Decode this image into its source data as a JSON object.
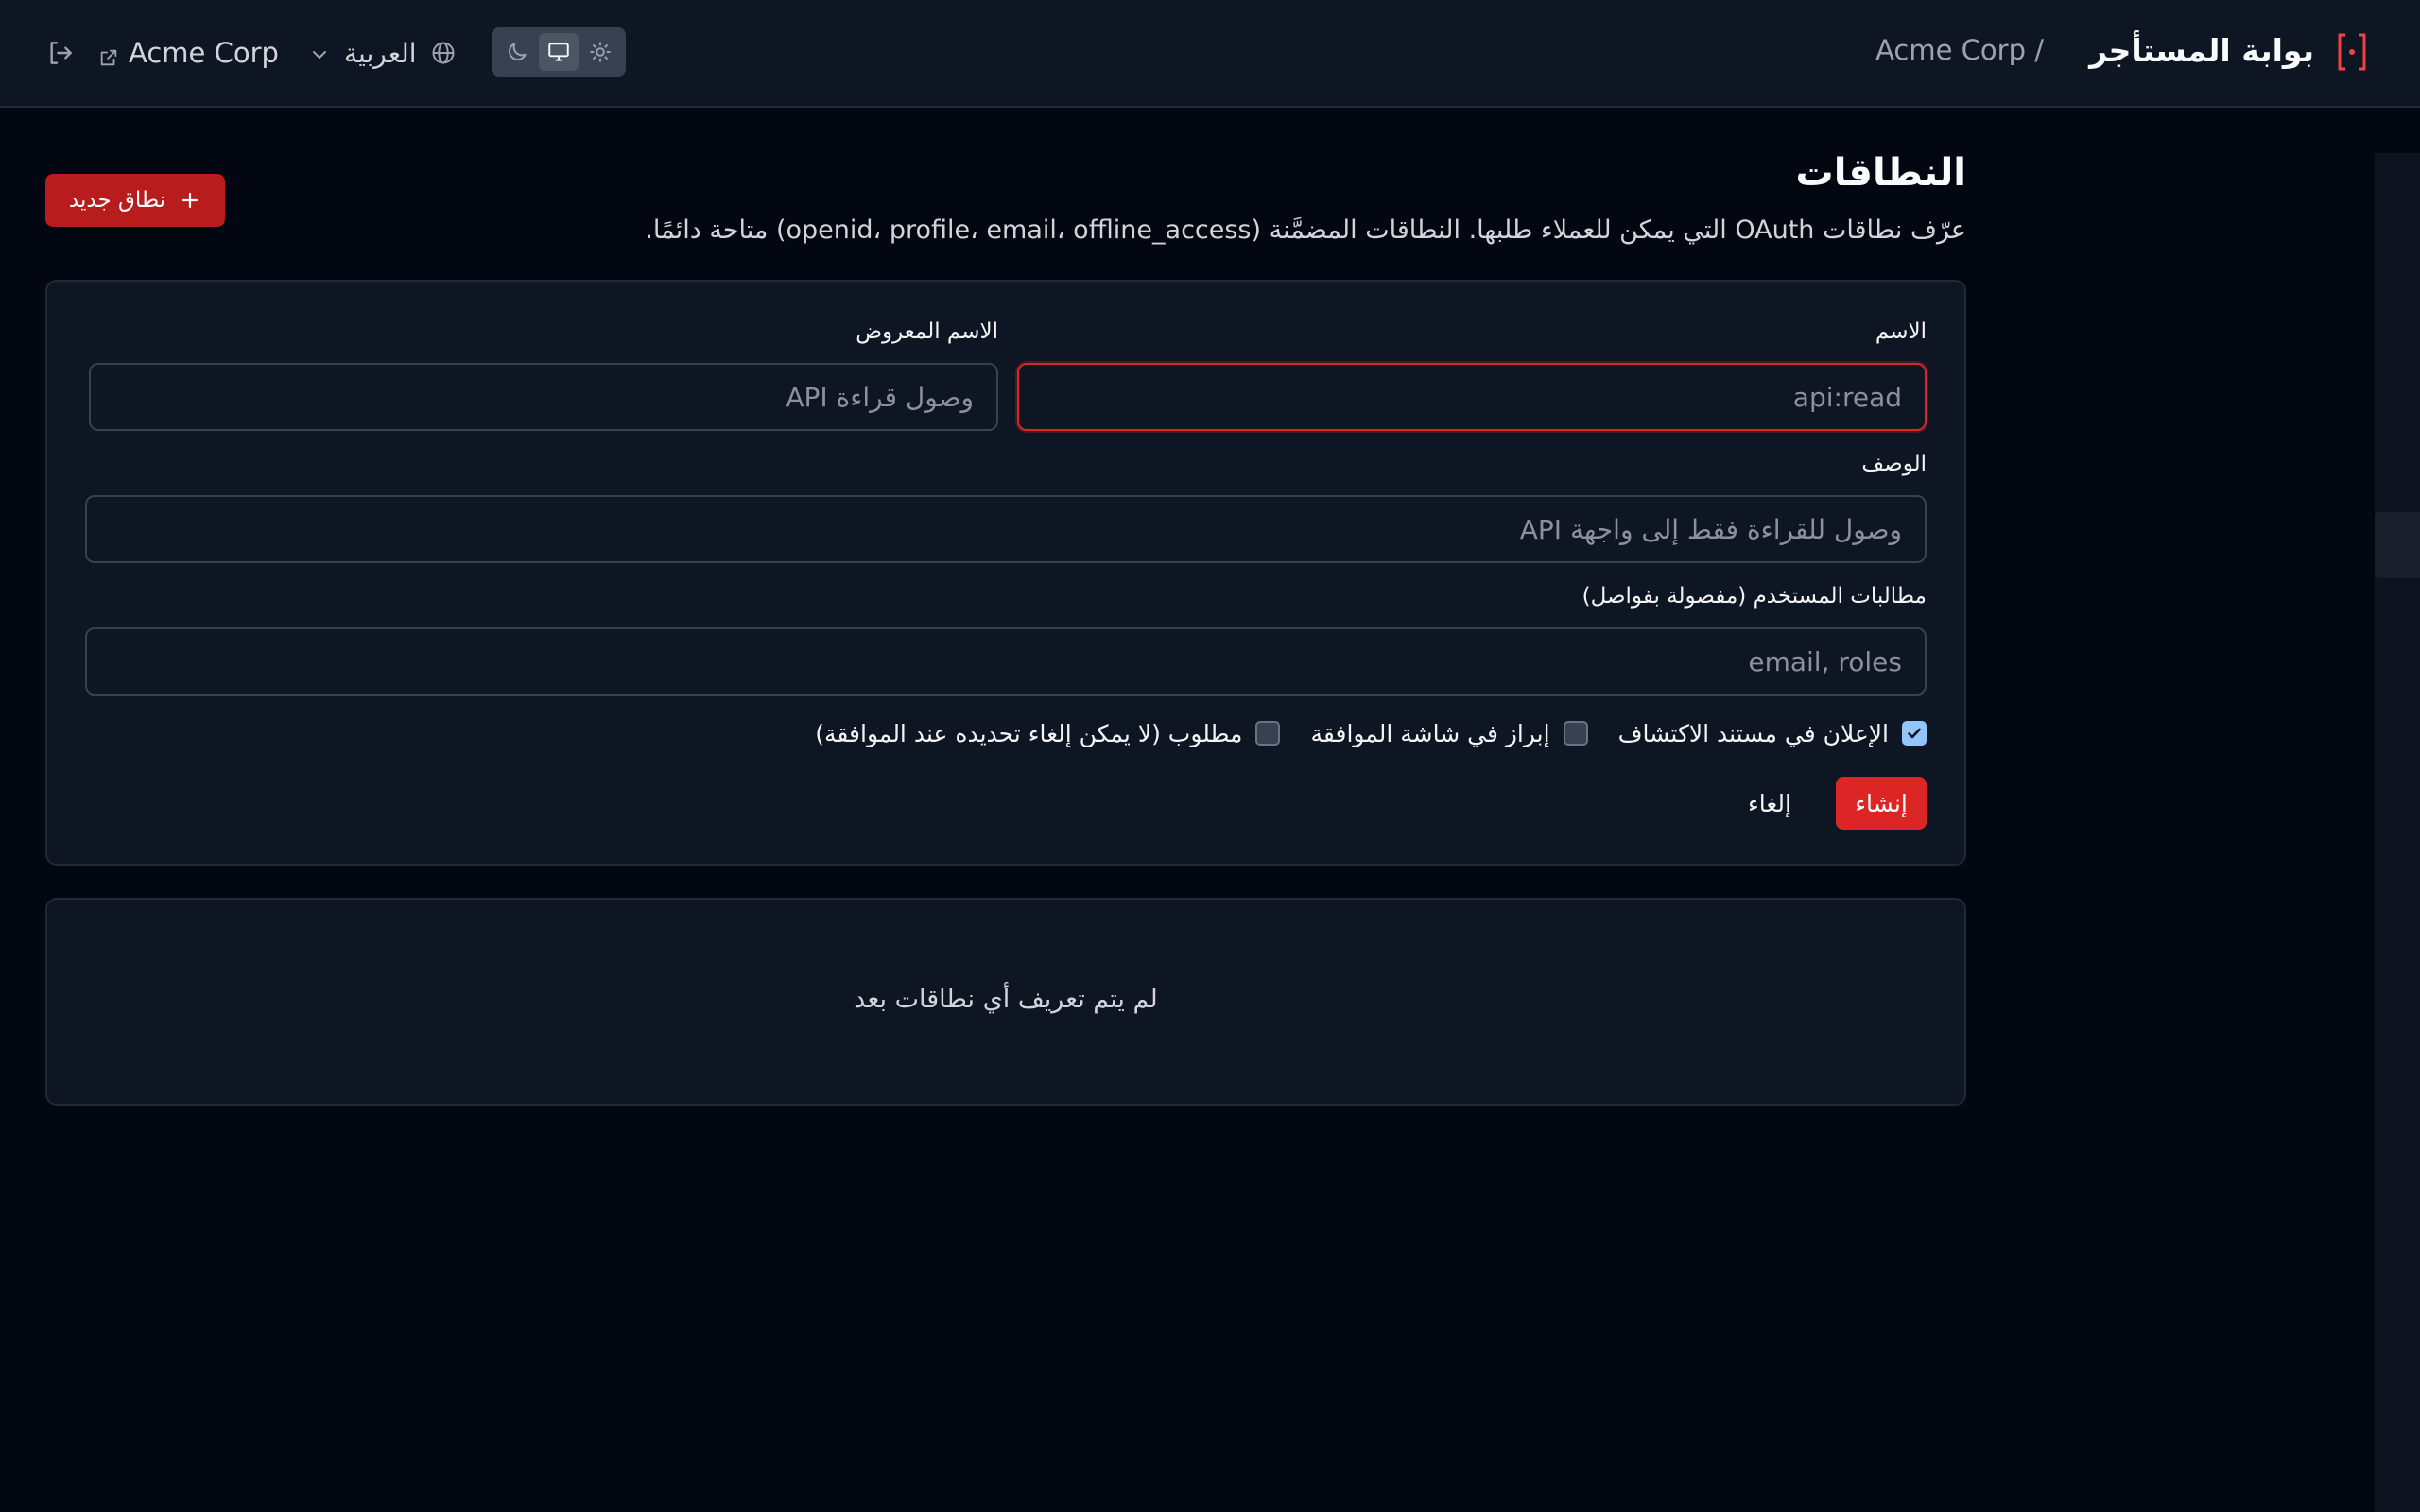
{
  "header": {
    "portal_title": "بوابة المستأجر",
    "breadcrumb": "Acme Corp /",
    "tenant_link": "Acme Corp",
    "language": "العربية",
    "theme_mode": "system"
  },
  "page": {
    "title": "النطاقات",
    "subtitle": "عرّف نطاقات OAuth التي يمكن للعملاء طلبها. النطاقات المضمَّنة (openid، profile، email، offline_access) متاحة دائمًا.",
    "new_button": "نطاق جديد"
  },
  "form": {
    "name_label": "الاسم",
    "name_placeholder": "api:read",
    "display_name_label": "الاسم المعروض",
    "display_name_placeholder": "وصول قراءة API",
    "description_label": "الوصف",
    "description_placeholder": "وصول للقراءة فقط إلى واجهة API",
    "claims_label": "مطالبات المستخدم (مفصولة بفواصل)",
    "claims_placeholder": "email, roles",
    "checkboxes": {
      "discovery": {
        "label": "الإعلان في مستند الاكتشاف",
        "checked": true
      },
      "consent": {
        "label": "إبراز في شاشة الموافقة",
        "checked": false
      },
      "required": {
        "label": "مطلوب (لا يمكن إلغاء تحديده عند الموافقة)",
        "checked": false
      }
    },
    "create_button": "إنشاء",
    "cancel_button": "إلغاء"
  },
  "empty_state": "لم يتم تعريف أي نطاقات بعد",
  "colors": {
    "accent": "#dc2626",
    "background": "#030712",
    "surface": "#0f1623",
    "checkbox_checked": "#93c5fd"
  }
}
